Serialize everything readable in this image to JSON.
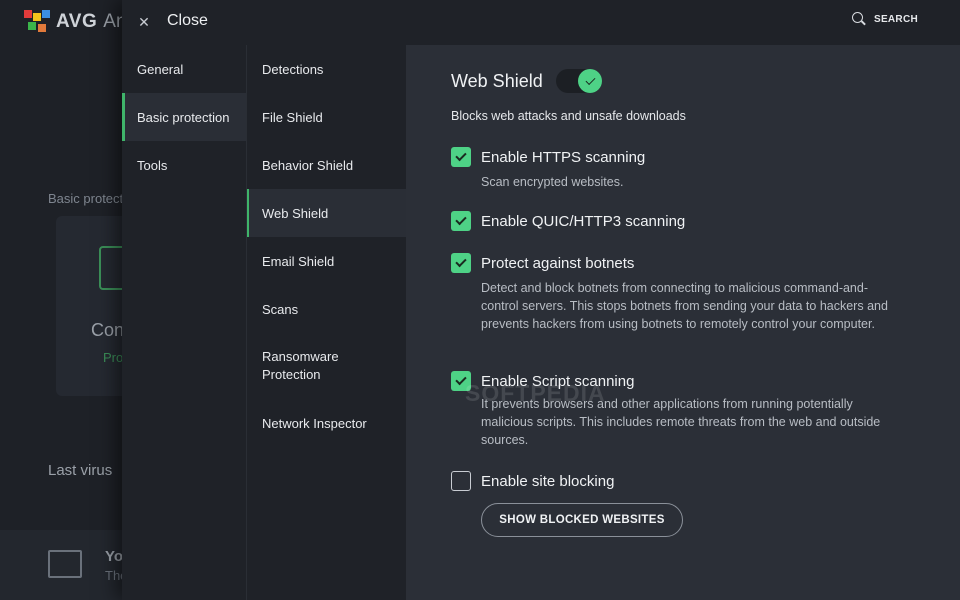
{
  "background": {
    "brand": "AVG",
    "product_fragment": "An",
    "section_fragment": "Basic protect",
    "card_title_fragment": "Con",
    "card_sub_fragment": "Pro",
    "last_virus_fragment": "Last virus",
    "bottom_title_fragment": "Yo",
    "bottom_sub_fragment": "The"
  },
  "topbar": {
    "close_label": "Close",
    "search_label": "SEARCH"
  },
  "nav1": {
    "items": [
      {
        "label": "General"
      },
      {
        "label": "Basic protection",
        "active": true
      },
      {
        "label": "Tools"
      }
    ]
  },
  "nav2": {
    "items": [
      {
        "label": "Detections"
      },
      {
        "label": "File Shield"
      },
      {
        "label": "Behavior Shield"
      },
      {
        "label": "Web Shield",
        "active": true
      },
      {
        "label": "Email Shield"
      },
      {
        "label": "Scans"
      },
      {
        "label": "Ransomware Protection"
      },
      {
        "label": "Network Inspector"
      }
    ]
  },
  "content": {
    "title": "Web Shield",
    "toggle_on": true,
    "description": "Blocks web attacks and unsafe downloads",
    "options": [
      {
        "label": "Enable HTTPS scanning",
        "checked": true,
        "desc": "Scan encrypted websites."
      },
      {
        "label": "Enable QUIC/HTTP3 scanning",
        "checked": true,
        "desc": ""
      },
      {
        "label": "Protect against botnets",
        "checked": true,
        "desc": "Detect and block botnets from connecting to malicious command-and-control servers. This stops botnets from sending your data to hackers and prevents hackers from using botnets to remotely control your computer."
      },
      {
        "label": "Enable Script scanning",
        "checked": true,
        "desc": "It prevents browsers and other applications from running potentially malicious scripts. This includes remote threats from the web and outside sources."
      },
      {
        "label": "Enable site blocking",
        "checked": false,
        "desc": ""
      }
    ],
    "button_label": "SHOW BLOCKED WEBSITES"
  },
  "watermark": "SOFTPEDIA",
  "colors": {
    "accent": "#4ed286",
    "accent_bar": "#3fb46a",
    "panel": "#262a31",
    "sidebar": "#1f2228",
    "content": "#2b2f37"
  }
}
